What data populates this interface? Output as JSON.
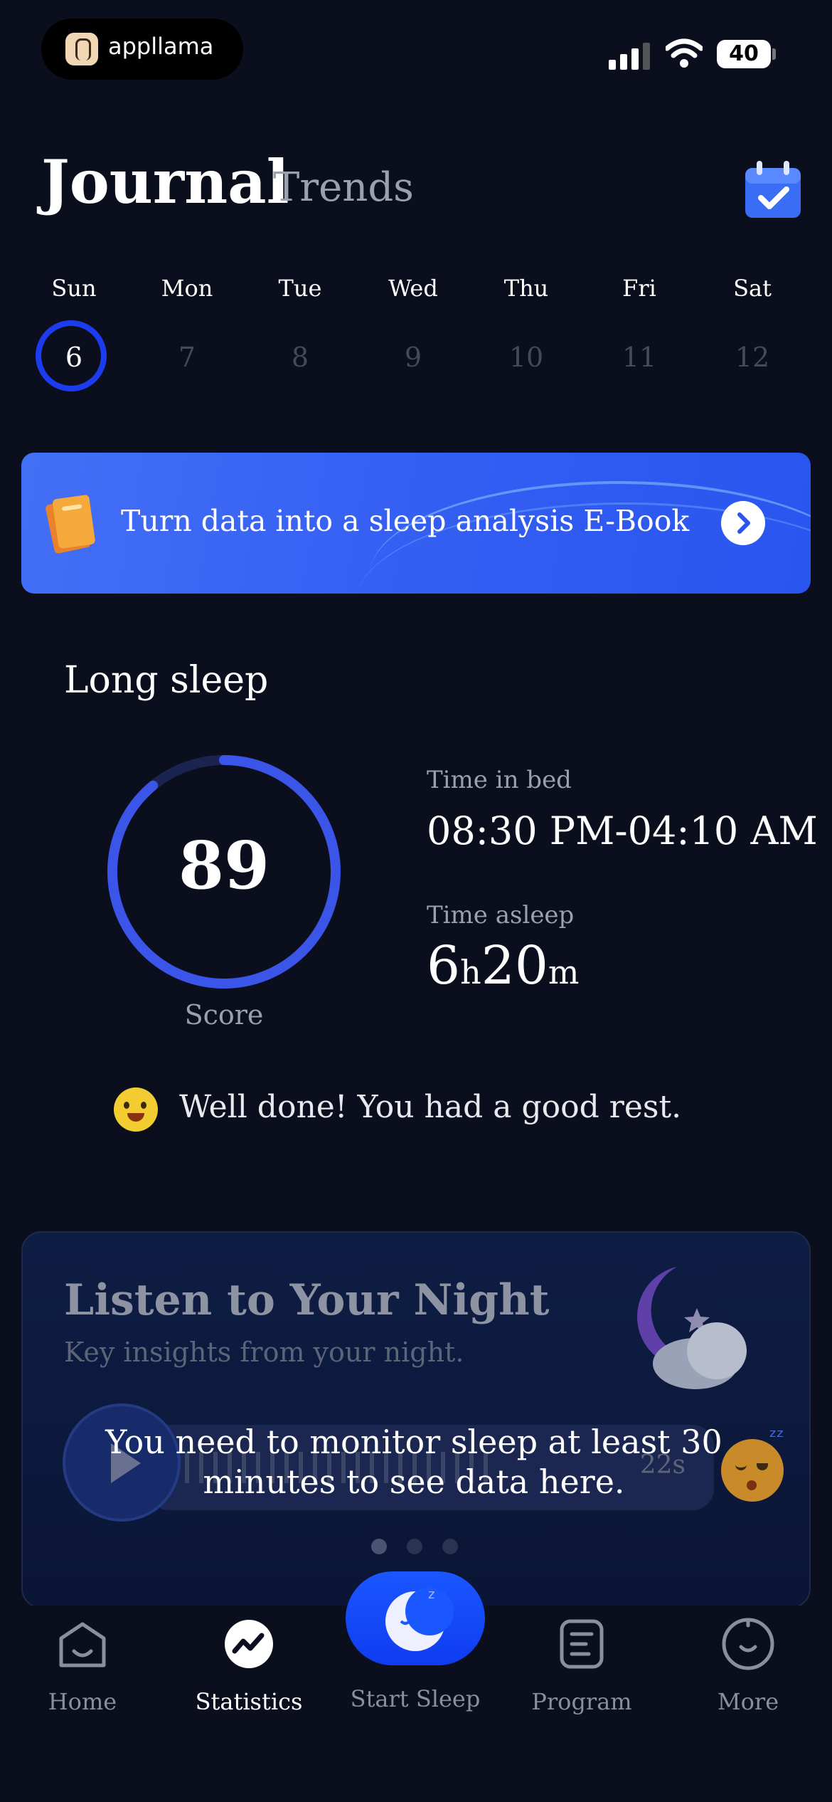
{
  "status_bar": {
    "brand": "appllama",
    "battery": "40"
  },
  "header": {
    "title": "Journal",
    "secondary_tab": "Trends"
  },
  "week": {
    "days": [
      "Sun",
      "Mon",
      "Tue",
      "Wed",
      "Thu",
      "Fri",
      "Sat"
    ],
    "dates": [
      "6",
      "7",
      "8",
      "9",
      "10",
      "11",
      "12"
    ],
    "selected_index": 0
  },
  "banner": {
    "text": "Turn data into a sleep analysis E-Book"
  },
  "sleep": {
    "section_title": "Long sleep",
    "score": "89",
    "score_fraction": 0.89,
    "score_label": "Score",
    "time_in_bed_label": "Time in bed",
    "time_in_bed": "08:30 PM-04:10 AM",
    "time_asleep_label": "Time asleep",
    "asleep_hours": "6",
    "asleep_h_unit": "h",
    "asleep_minutes": "20",
    "asleep_m_unit": "m",
    "message": "Well done! You had a good rest."
  },
  "listen_card": {
    "title": "Listen to Your Night",
    "subtitle": "Key insights from your night.",
    "duration": "22s",
    "overlay_message": "You need to monitor sleep at least 30 minutes to see data here.",
    "page_count": 3,
    "active_page": 0
  },
  "tabbar": {
    "home": "Home",
    "statistics": "Statistics",
    "start_sleep": "Start Sleep",
    "program": "Program",
    "more": "More",
    "active": "statistics"
  },
  "colors": {
    "background": "#0b0f1d",
    "accent": "#1d3cf0",
    "gauge": "#3a55e8",
    "banner": "#3560f3",
    "muted_text": "#9aa0ad"
  }
}
